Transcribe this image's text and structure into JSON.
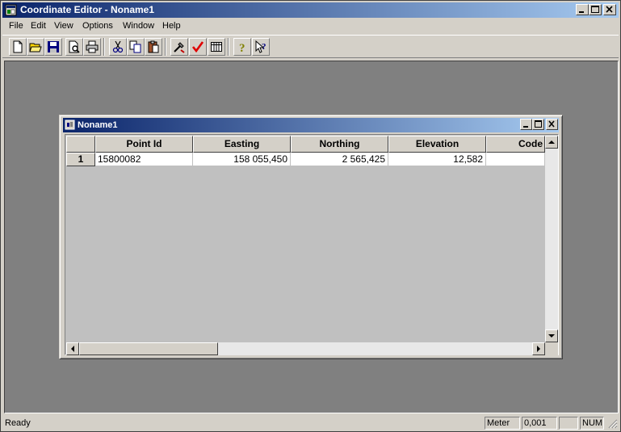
{
  "window": {
    "title": "Coordinate Editor - Noname1"
  },
  "menu": [
    "File",
    "Edit",
    "View",
    "Options",
    "Window",
    "Help"
  ],
  "toolbar": {
    "icons": [
      "new-file-icon",
      "open-folder-icon",
      "save-icon",
      "print-preview-icon",
      "print-icon",
      "cut-icon",
      "copy-icon",
      "paste-icon",
      "tools-icon",
      "checkmark-icon",
      "grid-icon",
      "help-icon",
      "context-help-icon"
    ]
  },
  "document": {
    "title": "Noname1",
    "columns": [
      "Point Id",
      "Easting",
      "Northing",
      "Elevation",
      "Code"
    ],
    "rows": [
      {
        "num": "1",
        "point_id": "15800082",
        "easting": "158 055,450",
        "northing": "2 565,425",
        "elevation": "12,582",
        "code": ""
      }
    ]
  },
  "status": {
    "text": "Ready",
    "units": "Meter",
    "precision": "0,001",
    "empty": "",
    "num": "NUM"
  },
  "colors": {
    "title_start": "#0a246a",
    "title_end": "#a6caf0",
    "workspace": "#808080",
    "face": "#d4d0c8"
  }
}
